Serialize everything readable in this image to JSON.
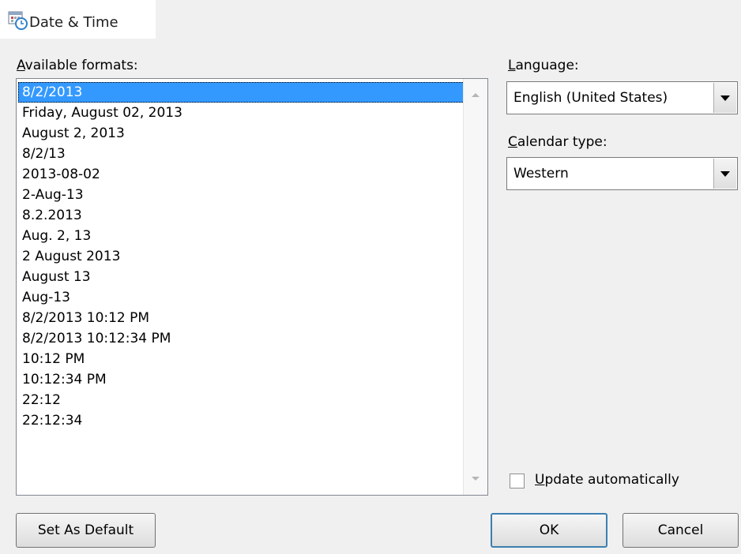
{
  "window": {
    "title": "Date & Time",
    "icon": "calendar-clock-icon"
  },
  "formats": {
    "label": "Available formats:",
    "items": [
      "8/2/2013",
      "Friday, August 02, 2013",
      "August 2, 2013",
      "8/2/13",
      "2013-08-02",
      "2-Aug-13",
      "8.2.2013",
      "Aug. 2, 13",
      "2 August 2013",
      "August 13",
      "Aug-13",
      "8/2/2013 10:12 PM",
      "8/2/2013 10:12:34 PM",
      "10:12 PM",
      "10:12:34 PM",
      "22:12",
      "22:12:34"
    ],
    "selected": "8/2/2013"
  },
  "language": {
    "label": "Language:",
    "value": "English (United States)"
  },
  "calendar": {
    "label": "Calendar type:",
    "value": "Western"
  },
  "update": {
    "label": "Update automatically",
    "checked": false
  },
  "buttons": {
    "set_default": "Set As Default",
    "ok": "OK",
    "cancel": "Cancel"
  },
  "colors": {
    "selection": "#3399ff",
    "default_button_border": "#3c7fb1",
    "dialog_bg": "#f0f0f0"
  }
}
